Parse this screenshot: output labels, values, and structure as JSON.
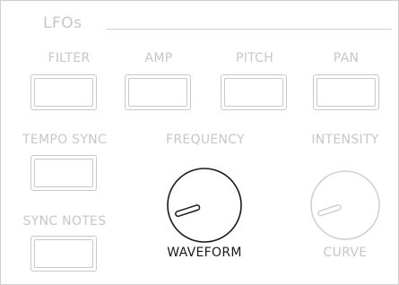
{
  "section": {
    "title": "LFOs"
  },
  "targets": [
    {
      "label": "FILTER",
      "active": false
    },
    {
      "label": "AMP",
      "active": false
    },
    {
      "label": "PITCH",
      "active": false
    },
    {
      "label": "PAN",
      "active": false
    }
  ],
  "tempo_sync": {
    "label": "TEMPO SYNC",
    "active": false
  },
  "sync_notes": {
    "label": "SYNC NOTES",
    "active": false
  },
  "frequency": {
    "label": "FREQUENCY",
    "active": false
  },
  "intensity": {
    "label": "INTENSITY",
    "active": false
  },
  "waveform": {
    "label": "WAVEFORM",
    "active": true,
    "value": 0.1
  },
  "curve": {
    "label": "CURVE",
    "active": false,
    "value": 0.1
  },
  "colors": {
    "active": "#1a1a1a",
    "inactive": "#c7c7c7",
    "border": "#cfcfcf"
  }
}
